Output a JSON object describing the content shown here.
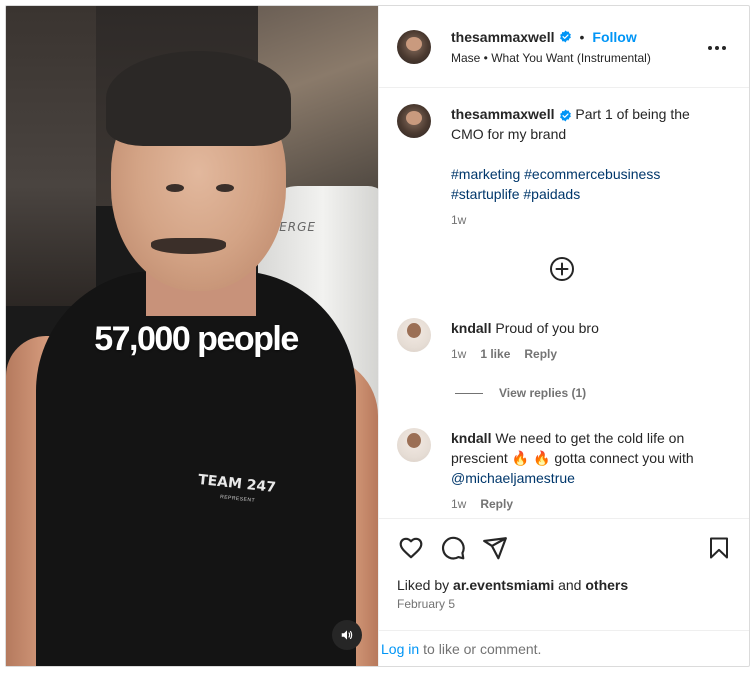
{
  "post": {
    "author": "thesammaxwell",
    "follow_label": "Follow",
    "dot": "•",
    "audio": "Mase • What You Want (Instrumental)",
    "verified_icon": "verified-badge-icon",
    "more_icon": "more-options-icon"
  },
  "media": {
    "overlay_text": "57,000 people",
    "shirt_text": "TEAM 247",
    "shirt_subtext": "REPRESENT",
    "chair_logo": "ERGE",
    "sound_icon": "speaker-icon"
  },
  "caption": {
    "username": "thesammaxwell",
    "text": "Part 1 of being the CMO for my brand",
    "hashtags_line1": "#marketing #ecommercebusiness",
    "hashtags_line2": "#startuplife #paidads",
    "time": "1w"
  },
  "add_comment_icon": "plus-circle-icon",
  "comments": [
    {
      "username": "kndall",
      "text": "Proud of you bro",
      "time": "1w",
      "likes": "1 like",
      "reply_label": "Reply"
    },
    {
      "username": "kndall",
      "text_before": "We need to get the cold life on prescient",
      "emojis": "🔥 🔥",
      "text_after": "gotta connect you with",
      "mention": "@michaeljamestrue",
      "time": "1w",
      "reply_label": "Reply"
    }
  ],
  "view_replies": "View replies (1)",
  "actions": {
    "like_icon": "heart-icon",
    "comment_icon": "comment-bubble-icon",
    "share_icon": "paper-plane-icon",
    "save_icon": "bookmark-icon"
  },
  "likes": {
    "prefix": "Liked by",
    "user": "ar.eventsmiami",
    "conj": "and",
    "others": "others"
  },
  "date": "February 5",
  "login_bar": {
    "login_label": "Log in",
    "suffix": "to like or comment."
  },
  "colors": {
    "accent": "#0095f6",
    "link": "#00376b",
    "muted": "#737373",
    "text": "#262626"
  }
}
